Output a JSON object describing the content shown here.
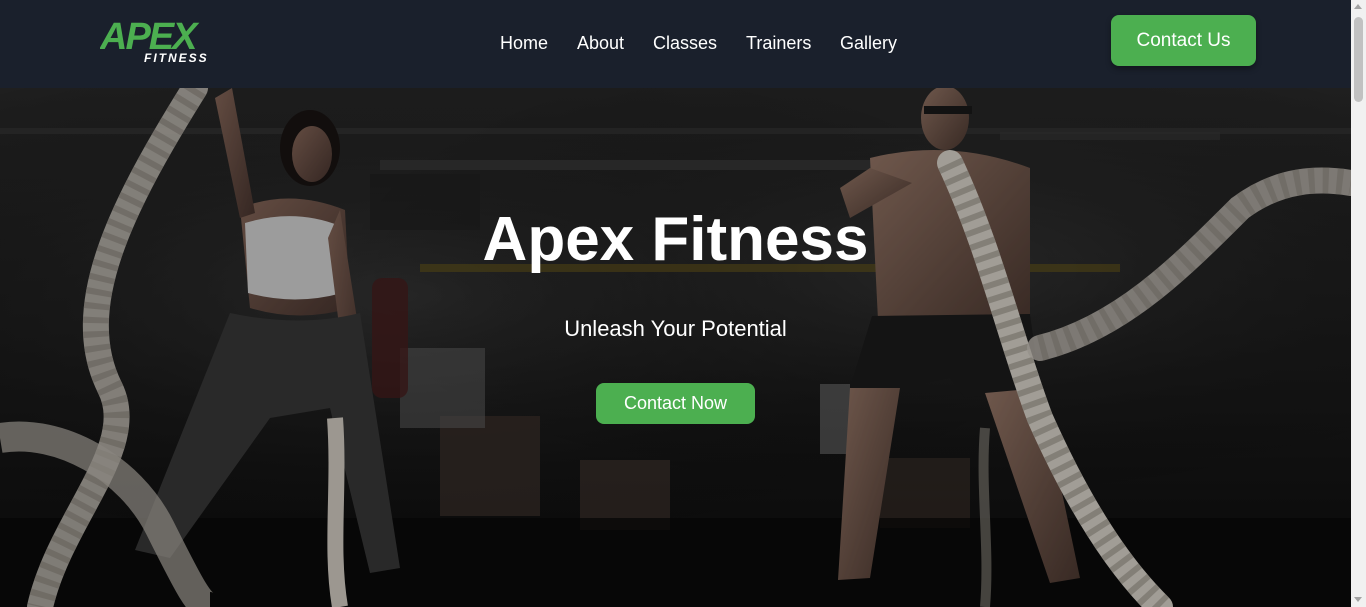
{
  "brand": {
    "logo_main": "APEX",
    "logo_sub": "FITNESS",
    "logo_color": "#4caf50"
  },
  "nav": {
    "items": [
      {
        "label": "Home"
      },
      {
        "label": "About"
      },
      {
        "label": "Classes"
      },
      {
        "label": "Trainers"
      },
      {
        "label": "Gallery"
      }
    ],
    "cta_label": "Contact Us"
  },
  "hero": {
    "title": "Apex Fitness",
    "subtitle": "Unleash Your Potential",
    "cta_label": "Contact Now",
    "background_image": "gym-battle-ropes-photo"
  },
  "colors": {
    "navbar_bg": "#1a202c",
    "accent": "#4caf50",
    "text": "#ffffff"
  }
}
